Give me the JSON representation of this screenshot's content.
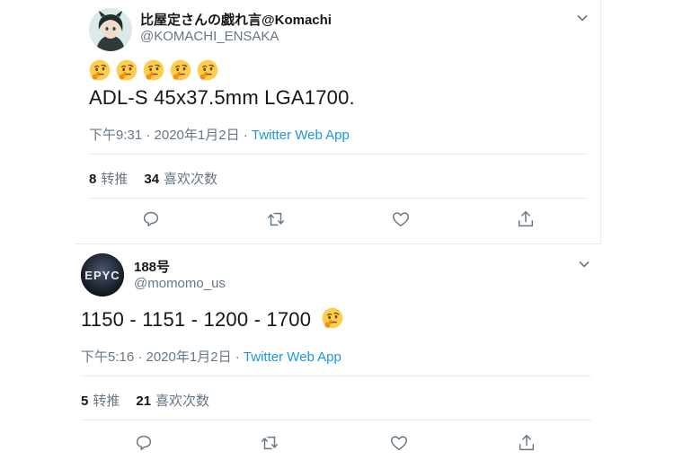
{
  "tweets": [
    {
      "author_name": "比屋定さんの戯れ言@Komachi",
      "author_handle": "@KOMACHI_ENSAKA",
      "emojis": [
        "thinking-face-emoji",
        "thinking-face-emoji",
        "thinking-face-emoji",
        "thinking-face-emoji",
        "thinking-face-emoji"
      ],
      "text": "ADL-S 45x37.5mm LGA1700.",
      "time": "下午9:31 · 2020年1月2日 · ",
      "app": "Twitter Web App",
      "retweets_count": "8",
      "retweets_label": "转推",
      "likes_count": "34",
      "likes_label": "喜欢次数"
    },
    {
      "author_name": "188号",
      "author_handle": "@momomo_us",
      "avatar_text": "EPYC",
      "text": "1150 - 1151 - 1200 - 1700",
      "time": "下午5:16 · 2020年1月2日 · ",
      "app": "Twitter Web App",
      "retweets_count": "5",
      "retweets_label": "转推",
      "likes_count": "21",
      "likes_label": "喜欢次数"
    }
  ],
  "icons": [
    "chevron-down-icon",
    "reply-icon",
    "retweet-icon",
    "like-icon",
    "share-icon"
  ],
  "colors": {
    "link": "#1b95e0",
    "secondary_text": "#657786",
    "border": "#e6ecf0",
    "emoji": "#ffcc4d"
  }
}
